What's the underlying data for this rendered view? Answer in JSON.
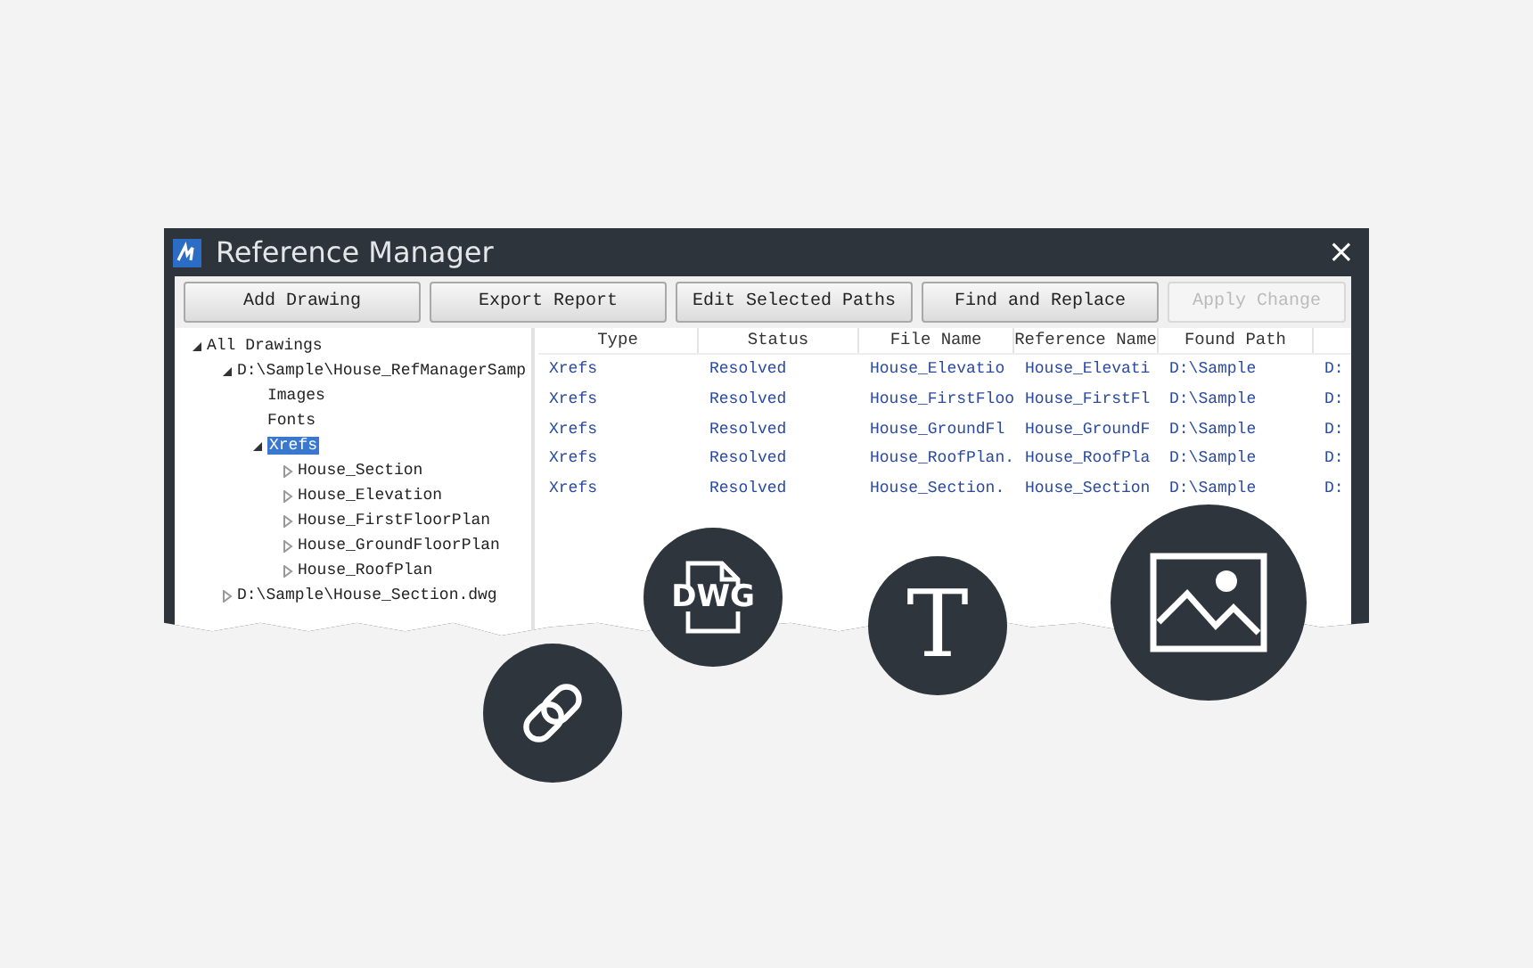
{
  "window": {
    "title": "Reference Manager",
    "close": "×"
  },
  "toolbar": [
    {
      "label": "Add Drawing",
      "disabled": false
    },
    {
      "label": "Export Report",
      "disabled": false
    },
    {
      "label": "Edit Selected Paths",
      "disabled": false
    },
    {
      "label": "Find and Replace",
      "disabled": false
    },
    {
      "label": "Apply Change",
      "disabled": true
    }
  ],
  "tree": [
    {
      "label": "All Drawings",
      "expanded": true,
      "selected": false,
      "children": [
        {
          "label": "D:\\Sample\\House_RefManagerSamp",
          "expanded": true,
          "selected": false,
          "children": [
            {
              "label": "Images",
              "selected": false
            },
            {
              "label": "Fonts",
              "selected": false
            },
            {
              "label": "Xrefs",
              "expanded": true,
              "selected": true,
              "children": [
                {
                  "label": "House_Section",
                  "expanded": false,
                  "selected": false
                },
                {
                  "label": "House_Elevation",
                  "expanded": false,
                  "selected": false
                },
                {
                  "label": "House_FirstFloorPlan",
                  "expanded": false,
                  "selected": false
                },
                {
                  "label": "House_GroundFloorPlan",
                  "expanded": false,
                  "selected": false
                },
                {
                  "label": "House_RoofPlan",
                  "expanded": false,
                  "selected": false
                }
              ]
            }
          ]
        },
        {
          "label": "D:\\Sample\\House_Section.dwg",
          "expanded": false,
          "selected": false
        }
      ]
    }
  ],
  "table": {
    "columns": [
      "Type",
      "Status",
      "File Name",
      "Reference Name",
      "Found Path"
    ],
    "rows": [
      [
        "Xrefs",
        "Resolved",
        "House_Elevatio",
        "House_Elevati",
        "D:\\Sample",
        "D:"
      ],
      [
        "Xrefs",
        "Resolved",
        "House_FirstFloo",
        "House_FirstFl",
        "D:\\Sample",
        "D:"
      ],
      [
        "Xrefs",
        "Resolved",
        "House_GroundFl",
        "House_GroundF",
        "D:\\Sample",
        "D:"
      ],
      [
        "Xrefs",
        "Resolved",
        "House_RoofPlan.",
        "House_RoofPla",
        "D:\\Sample",
        "D:"
      ],
      [
        "Xrefs",
        "Resolved",
        "House_Section.",
        "House_Section",
        "D:\\Sample",
        "D:"
      ]
    ]
  },
  "badges": [
    {
      "kind": "link"
    },
    {
      "kind": "dwg",
      "text": "DWG"
    },
    {
      "kind": "text",
      "text": "T"
    },
    {
      "kind": "image"
    }
  ]
}
